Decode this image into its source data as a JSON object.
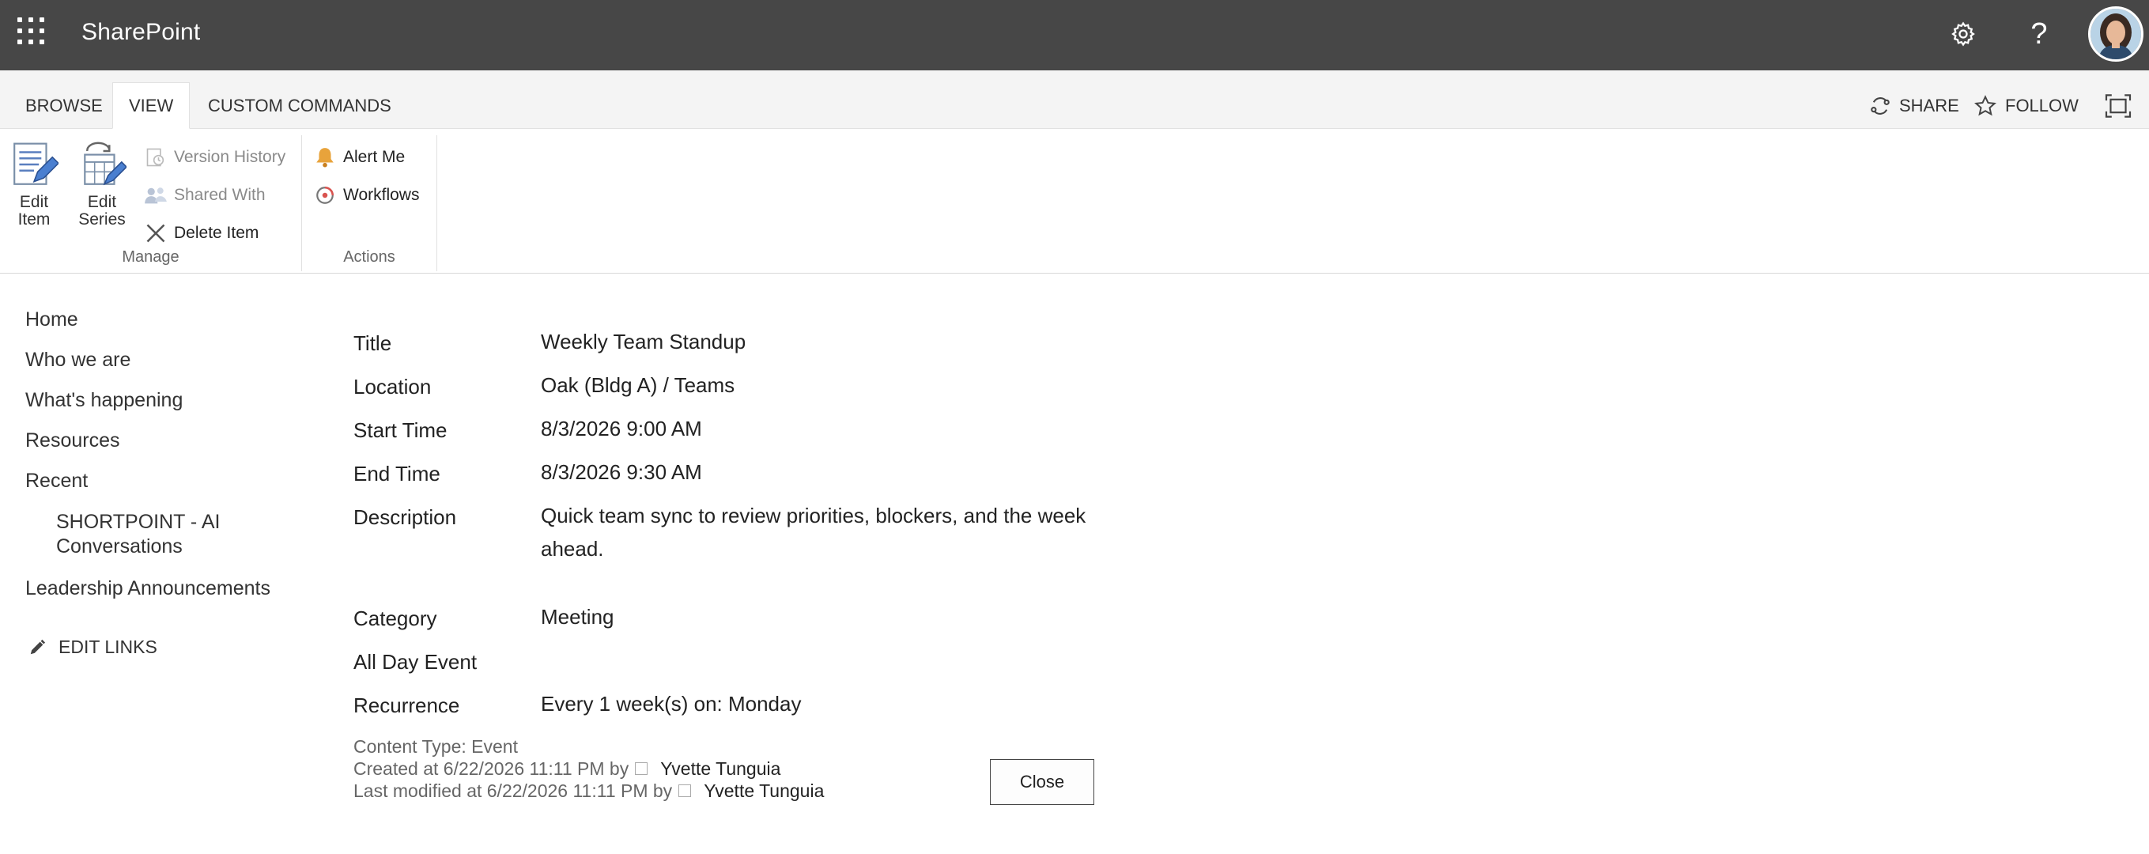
{
  "suite_bar": {
    "app_name": "SharePoint",
    "settings_icon": "gear-icon",
    "help_label": "?",
    "avatar_icon": "user-avatar"
  },
  "ribbon": {
    "tabs": [
      {
        "label": "BROWSE",
        "active": false
      },
      {
        "label": "VIEW",
        "active": true
      },
      {
        "label": "CUSTOM COMMANDS",
        "active": false
      }
    ],
    "share_label": "SHARE",
    "follow_label": "FOLLOW",
    "groups": {
      "manage": {
        "label": "Manage",
        "edit_item": [
          "Edit",
          "Item"
        ],
        "edit_series": [
          "Edit",
          "Series"
        ],
        "version_history": "Version History",
        "shared_with": "Shared With",
        "delete_item": "Delete Item"
      },
      "actions": {
        "label": "Actions",
        "alert_me": "Alert Me",
        "workflows": "Workflows"
      }
    }
  },
  "leftnav": {
    "items": [
      "Home",
      "Who we are",
      "What's happening",
      "Resources",
      "Recent",
      "SHORTPOINT - AI Conversations",
      "Leadership Announcements"
    ],
    "edit_links": "EDIT LINKS"
  },
  "form": {
    "fields": [
      {
        "label": "Title",
        "value": "Weekly Team Standup"
      },
      {
        "label": "Location",
        "value": "Oak (Bldg A) / Teams"
      },
      {
        "label": "Start Time",
        "value": "8/3/2026 9:00 AM"
      },
      {
        "label": "End Time",
        "value": "8/3/2026 9:30 AM"
      },
      {
        "label": "Description",
        "value": "Quick team sync to review priorities, blockers, and the week ahead."
      },
      {
        "label": "Category",
        "value": "Meeting"
      },
      {
        "label": "All Day Event",
        "value": ""
      },
      {
        "label": "Recurrence",
        "value": "Every 1 week(s) on: Monday"
      }
    ],
    "meta": {
      "content_type": "Content Type: Event",
      "created_prefix": "Created at 6/22/2026 11:11 PM by",
      "created_by": "Yvette Tunguia",
      "modified_prefix": "Last modified at 6/22/2026 11:11 PM by",
      "modified_by": "Yvette Tunguia"
    },
    "close_label": "Close"
  },
  "colors": {
    "suite_bar": "#474747",
    "ribbon_tabs_bg": "#f4f4f4",
    "alert_bell": "#e8a33b"
  }
}
